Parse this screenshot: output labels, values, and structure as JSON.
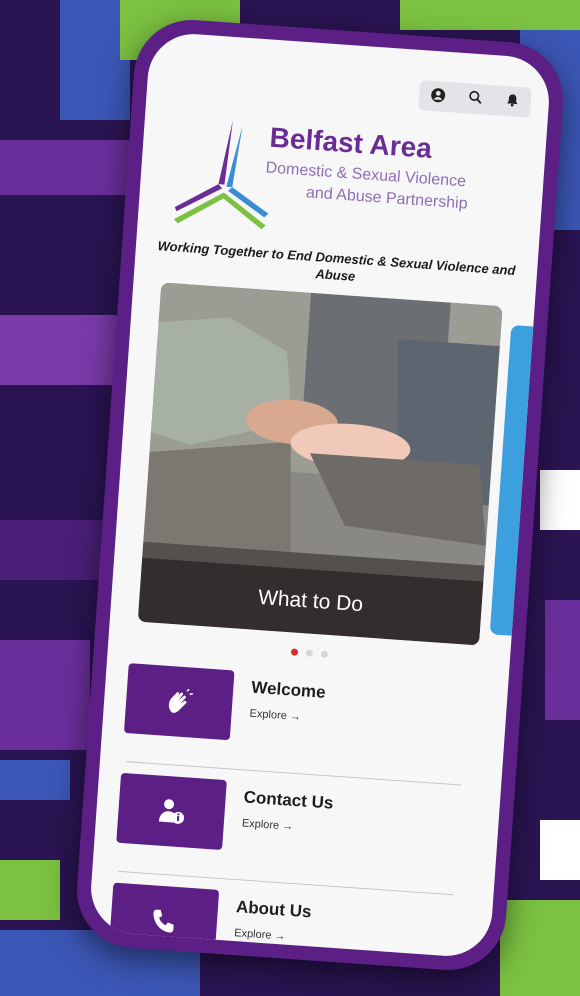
{
  "header": {
    "icons": [
      "user-circle-icon",
      "search-icon",
      "bell-icon"
    ]
  },
  "logo": {
    "title": "Belfast Area",
    "subtitle_line1": "Domestic & Sexual Violence",
    "subtitle_line2": "and Abuse Partnership"
  },
  "tagline": "Working Together to End Domestic & Sexual Violence and Abuse",
  "carousel": {
    "caption": "What to Do",
    "slide_count": 3,
    "active_index": 0,
    "colors": {
      "dot_active": "#e02828",
      "dot_inactive": "#d6d6d6",
      "next_slide": "#3ba0dd"
    }
  },
  "menu": [
    {
      "title": "Welcome",
      "explore": "Explore →",
      "icon": "clapping-hands-icon"
    },
    {
      "title": "Contact Us",
      "explore": "Explore →",
      "icon": "user-info-icon"
    },
    {
      "title": "About Us",
      "explore": "Explore →",
      "icon": "phone-icon"
    }
  ],
  "colors": {
    "brand_purple": "#5b1f86",
    "background": "#2a1452"
  }
}
